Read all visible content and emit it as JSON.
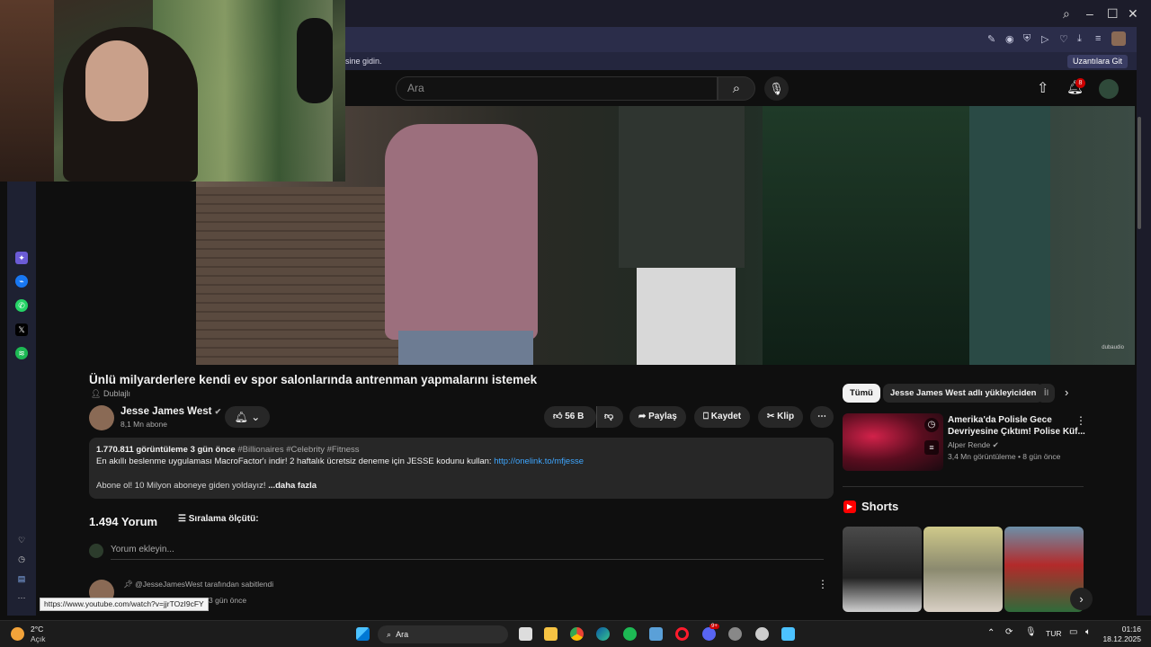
{
  "browser": {
    "info_text": "sine gidin.",
    "extensions_button": "Uzantılara Git"
  },
  "youtube": {
    "search_placeholder": "Ara",
    "notification_count": "8"
  },
  "video": {
    "title": "Ünlü milyarderlere kendi ev spor salonlarında antrenman yapmalarını istemek",
    "dubbed": "Dublajlı",
    "channel": "Jesse James West",
    "subscribers": "8,1 Mn abone",
    "likes": "56 B",
    "share": "Paylaş",
    "save": "Kaydet",
    "clip": "Klip",
    "watermark": "dubaudio"
  },
  "description": {
    "views": "1.770.811 görüntüleme",
    "age": "3 gün önce",
    "tags": "#Billionaires #Celebrity #Fitness",
    "line1": "En akıllı beslenme uygulaması MacroFactor'ı indir! 2 haftalık ücretsiz deneme için JESSE kodunu kullan:",
    "link": "http://onelink.to/mfjesse",
    "line2": "Abone ol! 10 Milyon aboneye giden yoldayız!",
    "more": "...daha fazla"
  },
  "comments": {
    "count": "1.494 Yorum",
    "sort_label": "Sıralama ölçütü:",
    "input_placeholder": "Yorum ekleyin...",
    "pinned_by": "@JesseJamesWest tarafından sabitlendi",
    "pinned_time": "3 gün önce"
  },
  "status_url": "https://www.youtube.com/watch?v=jjrTOzI9cFY",
  "sidebar_right": {
    "chips": [
      "Tümü",
      "Jesse James West adlı yükleyiciden",
      "İl"
    ],
    "recommended": {
      "title_line1": "Amerika'da Polisle Gece",
      "title_line2": "Devriyesine Çıktım! Polise Küf...",
      "channel": "Alper Rende",
      "meta": "3,4 Mn görüntüleme • 8 gün önce"
    },
    "shorts_title": "Shorts"
  },
  "taskbar": {
    "weather_temp": "2°C",
    "weather_desc": "Açık",
    "search_label": "Ara",
    "lang": "TUR",
    "time": "01:16",
    "date": "18.12.2025",
    "badge": "9+"
  },
  "colors": {
    "yt_bg": "#0f0f0f",
    "pill_bg": "#272727",
    "link": "#3ea6ff",
    "browser_chrome": "#2b2d4a",
    "notification": "#cc0000"
  }
}
